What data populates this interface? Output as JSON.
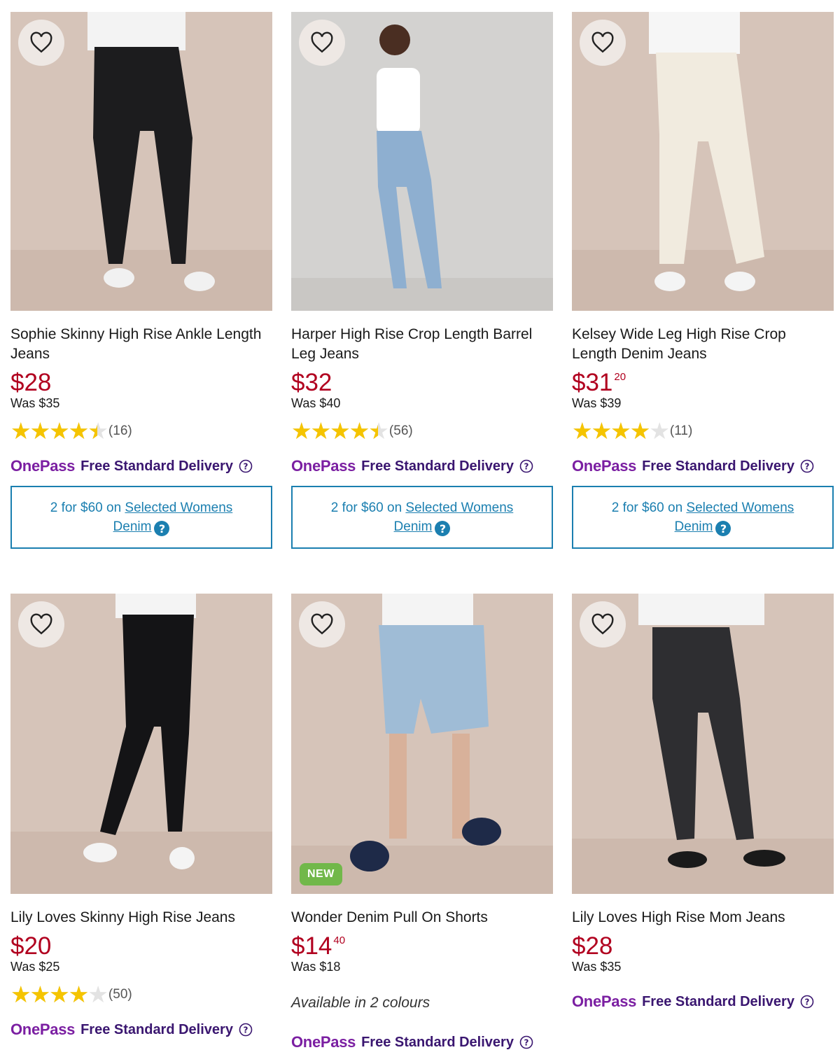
{
  "products": [
    {
      "name": "Sophie Skinny High Rise Ankle Length Jeans",
      "price_main": "$28",
      "price_cents": "",
      "was": "Was $35",
      "rating": 4.5,
      "review_count": "(16)",
      "delivery_brand": "OnePass",
      "delivery_text": "Free Standard Delivery",
      "promo_prefix": "2 for $60 on ",
      "promo_link": "Selected Womens Denim",
      "pant_color": "#1c1c1e",
      "top_color": "#f4f4f4"
    },
    {
      "name": "Harper High Rise Crop Length Barrel Leg Jeans",
      "price_main": "$32",
      "price_cents": "",
      "was": "Was $40",
      "rating": 4.5,
      "review_count": "(56)",
      "delivery_brand": "OnePass",
      "delivery_text": "Free Standard Delivery",
      "promo_prefix": "2 for $60 on ",
      "promo_link": "Selected Womens Denim",
      "pant_color": "#8eafd0",
      "top_color": "#ffffff"
    },
    {
      "name": "Kelsey Wide Leg High Rise Crop Length Denim Jeans",
      "price_main": "$31",
      "price_cents": "20",
      "was": "Was $39",
      "rating": 4,
      "review_count": "(11)",
      "delivery_brand": "OnePass",
      "delivery_text": "Free Standard Delivery",
      "promo_prefix": "2 for $60 on ",
      "promo_link": "Selected Womens Denim",
      "pant_color": "#f1ebdf",
      "top_color": "#f4f4f4"
    },
    {
      "name": "Lily Loves Skinny High Rise Jeans",
      "price_main": "$20",
      "price_cents": "",
      "was": "Was $25",
      "rating": 4,
      "review_count": "(50)",
      "delivery_brand": "OnePass",
      "delivery_text": "Free Standard Delivery",
      "pant_color": "#141416",
      "top_color": "#f4f4f4"
    },
    {
      "name": "Wonder Denim Pull On Shorts",
      "price_main": "$14",
      "price_cents": "40",
      "was": "Was $18",
      "badge": "NEW",
      "colours_text": "Available in 2 colours",
      "delivery_brand": "OnePass",
      "delivery_text": "Free Standard Delivery",
      "pant_color": "#9fbcd6",
      "top_color": "#f4f4f4"
    },
    {
      "name": "Lily Loves High Rise Mom Jeans",
      "price_main": "$28",
      "price_cents": "",
      "was": "Was $35",
      "delivery_brand": "OnePass",
      "delivery_text": "Free Standard Delivery",
      "pant_color": "#2e2e31",
      "top_color": "#f4f4f4"
    }
  ],
  "colors": {
    "price": "#b1001f",
    "star": "#f5c400",
    "onepass": "#7b1fa2",
    "promo": "#1b7fb0",
    "new_badge": "#71b84a"
  },
  "icons": {
    "wishlist": "heart-outline-icon",
    "help": "question-circle-icon",
    "rating": "star-icon"
  }
}
